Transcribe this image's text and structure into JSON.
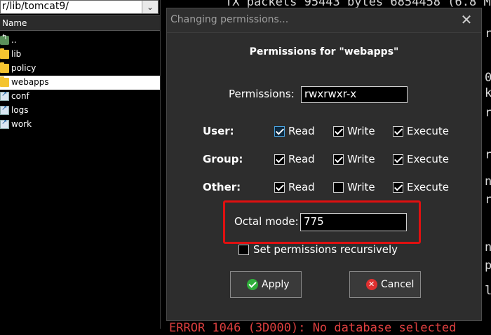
{
  "file_panel": {
    "path": "r/lib/tomcat9/",
    "column_header": "Name",
    "files": [
      {
        "name": "..",
        "icon": "parent-dir-icon",
        "selected": false
      },
      {
        "name": "lib",
        "icon": "folder-icon",
        "selected": false
      },
      {
        "name": "policy",
        "icon": "folder-icon",
        "selected": false
      },
      {
        "name": "webapps",
        "icon": "folder-icon",
        "selected": true
      },
      {
        "name": "conf",
        "icon": "link-icon",
        "selected": false
      },
      {
        "name": "logs",
        "icon": "link-icon",
        "selected": false
      },
      {
        "name": "work",
        "icon": "link-icon",
        "selected": false
      }
    ]
  },
  "terminal": {
    "top_line": "TX packets 95443  bytes 6854458 (6.8 M",
    "right_edge_chars": [
      "r",
      "0",
      "k",
      "r",
      "r",
      "n",
      "r",
      "n",
      "p",
      "l"
    ],
    "bottom_line_error": "ERROR 1046 (3D000): No database selected"
  },
  "dialog": {
    "title": "Changing permissions...",
    "heading": "Permissions for \"webapps\"",
    "permissions_label": "Permissions:",
    "permissions_value": "rwxrwxr-x",
    "rows": [
      {
        "label": "User:",
        "read": true,
        "write": true,
        "execute": true
      },
      {
        "label": "Group:",
        "read": true,
        "write": true,
        "execute": true
      },
      {
        "label": "Other:",
        "read": true,
        "write": false,
        "execute": true
      }
    ],
    "col_read": "Read",
    "col_write": "Write",
    "col_execute": "Execute",
    "octal_label": "Octal mode:",
    "octal_value": "775",
    "recursive_label": "Set permissions recursively",
    "recursive_checked": false,
    "apply_label": "Apply",
    "cancel_label": "Cancel",
    "highlight_color": "#e01010"
  }
}
